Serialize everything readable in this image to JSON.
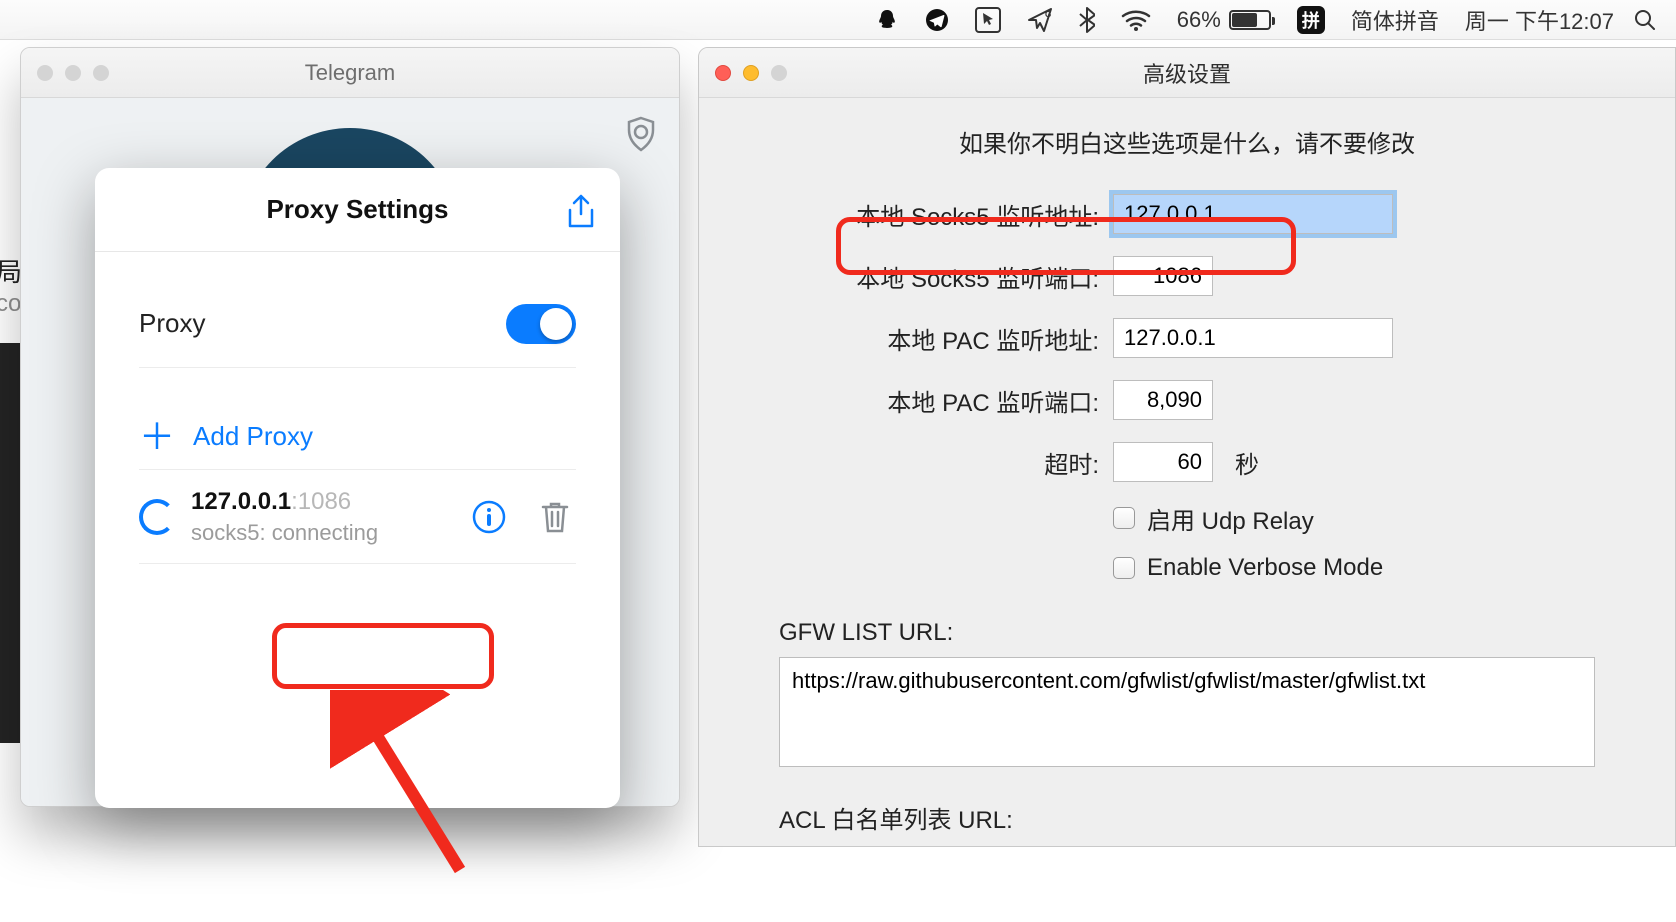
{
  "menubar": {
    "battery_pct": "66%",
    "ime_glyph": "拼",
    "ime_label": "简体拼音",
    "clock": "周一 下午12:07"
  },
  "telegram": {
    "title": "Telegram",
    "bg_text1": "局 杉",
    "bg_text2": "co"
  },
  "proxy": {
    "title": "Proxy Settings",
    "label": "Proxy",
    "add_label": "Add Proxy",
    "entry_ip": "127.0.0.1",
    "entry_port": ":1086",
    "entry_status": "socks5: connecting"
  },
  "adv": {
    "title": "高级设置",
    "warning": "如果你不明白这些选项是什么，请不要修改",
    "row1_label": "本地 Socks5 监听地址:",
    "row1_value": "127.0.0.1",
    "row2_label": "本地 Socks5 监听端口:",
    "row2_value": "1086",
    "row3_label": "本地 PAC 监听地址:",
    "row3_value": "127.0.0.1",
    "row4_label": "本地 PAC 监听端口:",
    "row4_value": "8,090",
    "row5_label": "超时:",
    "row5_value": "60",
    "row5_unit": "秒",
    "cb1_label": "启用 Udp Relay",
    "cb2_label": "Enable Verbose Mode",
    "gfw_label": "GFW LIST URL:",
    "gfw_value": "https://raw.githubusercontent.com/gfwlist/gfwlist/master/gfwlist.txt",
    "acl_label": "ACL 白名单列表 URL:"
  }
}
